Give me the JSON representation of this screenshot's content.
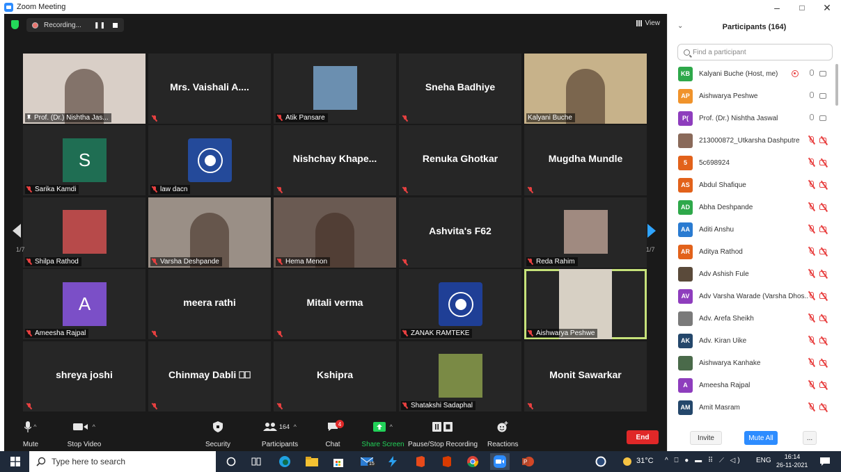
{
  "window": {
    "title": "Zoom Meeting",
    "minimize": "–",
    "maximize": "□",
    "close": "✕"
  },
  "topbar": {
    "recording": "Recording...",
    "pause": "❚❚",
    "view": "View"
  },
  "tiles": [
    {
      "name": "Prof. (Dr.) Nishtha Jas...",
      "label": true,
      "pinned": true,
      "type": "photo",
      "bg": "#d9cfc7"
    },
    {
      "name": "Mrs. Vaishali A....",
      "label": false,
      "type": "name"
    },
    {
      "name": "Atik Pansare",
      "label": true,
      "type": "photo-small",
      "bg": "#6b8fb0"
    },
    {
      "name": "Sneha Badhiye",
      "label": false,
      "type": "name"
    },
    {
      "name": "Kalyani Buche",
      "label": true,
      "type": "photo",
      "bg": "#c7b28a"
    },
    {
      "name": "Sarika Kamdi",
      "label": true,
      "type": "avatar",
      "letter": "S",
      "bg": "#1f6e53"
    },
    {
      "name": "law dacn",
      "label": true,
      "type": "logo",
      "bg": "#244a9a"
    },
    {
      "name": "Nishchay  Khape...",
      "label": false,
      "type": "name"
    },
    {
      "name": "Renuka Ghotkar",
      "label": false,
      "type": "name"
    },
    {
      "name": "Mugdha Mundle",
      "label": false,
      "type": "name"
    },
    {
      "name": "Shilpa Rathod",
      "label": true,
      "type": "photo-small",
      "bg": "#b74a4a"
    },
    {
      "name": "Varsha Deshpande",
      "label": true,
      "type": "photo",
      "bg": "#9a8f86"
    },
    {
      "name": "Hema Menon",
      "label": true,
      "type": "photo",
      "bg": "#6a5a52"
    },
    {
      "name": "Ashvita's F62",
      "label": false,
      "type": "name"
    },
    {
      "name": "Reda Rahim",
      "label": true,
      "type": "photo-small",
      "bg": "#a08a80"
    },
    {
      "name": "Ameesha Rajpal",
      "label": true,
      "type": "avatar",
      "letter": "A",
      "bg": "#7b4fc7"
    },
    {
      "name": "meera rathi",
      "label": false,
      "type": "name"
    },
    {
      "name": "Mitali verma",
      "label": false,
      "type": "name"
    },
    {
      "name": "ZANAK RAMTEKE",
      "label": true,
      "type": "logo",
      "bg": "#1f3f96"
    },
    {
      "name": "Aishwarya Peshwe",
      "label": true,
      "type": "photo-small",
      "bg": "#d7d0c4",
      "active": true
    },
    {
      "name": "shreya joshi",
      "label": false,
      "type": "name"
    },
    {
      "name": "Chinmay  Dabli ⎕⎕",
      "label": false,
      "type": "name"
    },
    {
      "name": "Kshipra",
      "label": false,
      "type": "name"
    },
    {
      "name": "Shatakshi Sadaphal",
      "label": true,
      "type": "photo-small",
      "bg": "#7a8a45"
    },
    {
      "name": "Monit Sawarkar",
      "label": false,
      "type": "name"
    }
  ],
  "pager": {
    "left": "1/7",
    "right": "1/7"
  },
  "toolbar": {
    "mute": "Mute",
    "stop_video": "Stop Video",
    "security": "Security",
    "participants": "Participants",
    "participants_count": "164",
    "chat": "Chat",
    "chat_badge": "4",
    "share": "Share Screen",
    "record": "Pause/Stop Recording",
    "reactions": "Reactions",
    "end": "End"
  },
  "panel": {
    "title": "Participants (164)",
    "search_placeholder": "Find a participant",
    "participants": [
      {
        "initials": "KB",
        "name": "Kalyani Buche (Host, me)",
        "color": "#2ea84a",
        "state": "host"
      },
      {
        "initials": "AP",
        "name": "Aishwarya Peshwe",
        "color": "#f0932b",
        "state": "on"
      },
      {
        "initials": "P(",
        "name": "Prof. (Dr.) Nishtha Jaswal",
        "color": "#8e3dbd",
        "state": "on"
      },
      {
        "initials": "",
        "name": "213000872_Utkarsha Dashputre",
        "color": "#8a6a5a",
        "state": "off"
      },
      {
        "initials": "5",
        "name": "5c698924",
        "color": "#e2621b",
        "state": "off"
      },
      {
        "initials": "AS",
        "name": "Abdul Shafique",
        "color": "#e2621b",
        "state": "off"
      },
      {
        "initials": "AD",
        "name": "Abha Deshpande",
        "color": "#2ea84a",
        "state": "off"
      },
      {
        "initials": "AA",
        "name": "Aditi Anshu",
        "color": "#2a7bd1",
        "state": "off"
      },
      {
        "initials": "AR",
        "name": "Aditya Rathod",
        "color": "#e2621b",
        "state": "off"
      },
      {
        "initials": "",
        "name": "Adv Ashish Fule",
        "color": "#5a4a3a",
        "state": "off"
      },
      {
        "initials": "AV",
        "name": "Adv Varsha Warade (Varsha Dhos...",
        "color": "#8e3dbd",
        "state": "off"
      },
      {
        "initials": "",
        "name": "Adv. Arefa Sheikh",
        "color": "#7a7a7a",
        "state": "off"
      },
      {
        "initials": "AK",
        "name": "Adv. Kiran Uike",
        "color": "#24476b",
        "state": "off"
      },
      {
        "initials": "",
        "name": "Aishwarya Kanhake",
        "color": "#4a6a4a",
        "state": "off"
      },
      {
        "initials": "A",
        "name": "Ameesha Rajpal",
        "color": "#8e3dbd",
        "state": "off"
      },
      {
        "initials": "AM",
        "name": "Amit Masram",
        "color": "#24476b",
        "state": "off"
      }
    ],
    "invite": "Invite",
    "mute_all": "Mute All",
    "more": "..."
  },
  "taskbar": {
    "search_placeholder": "Type here to search",
    "temperature": "31°C",
    "lang": "ENG",
    "time": "16:14",
    "date": "26-11-2021",
    "badge": "15"
  }
}
